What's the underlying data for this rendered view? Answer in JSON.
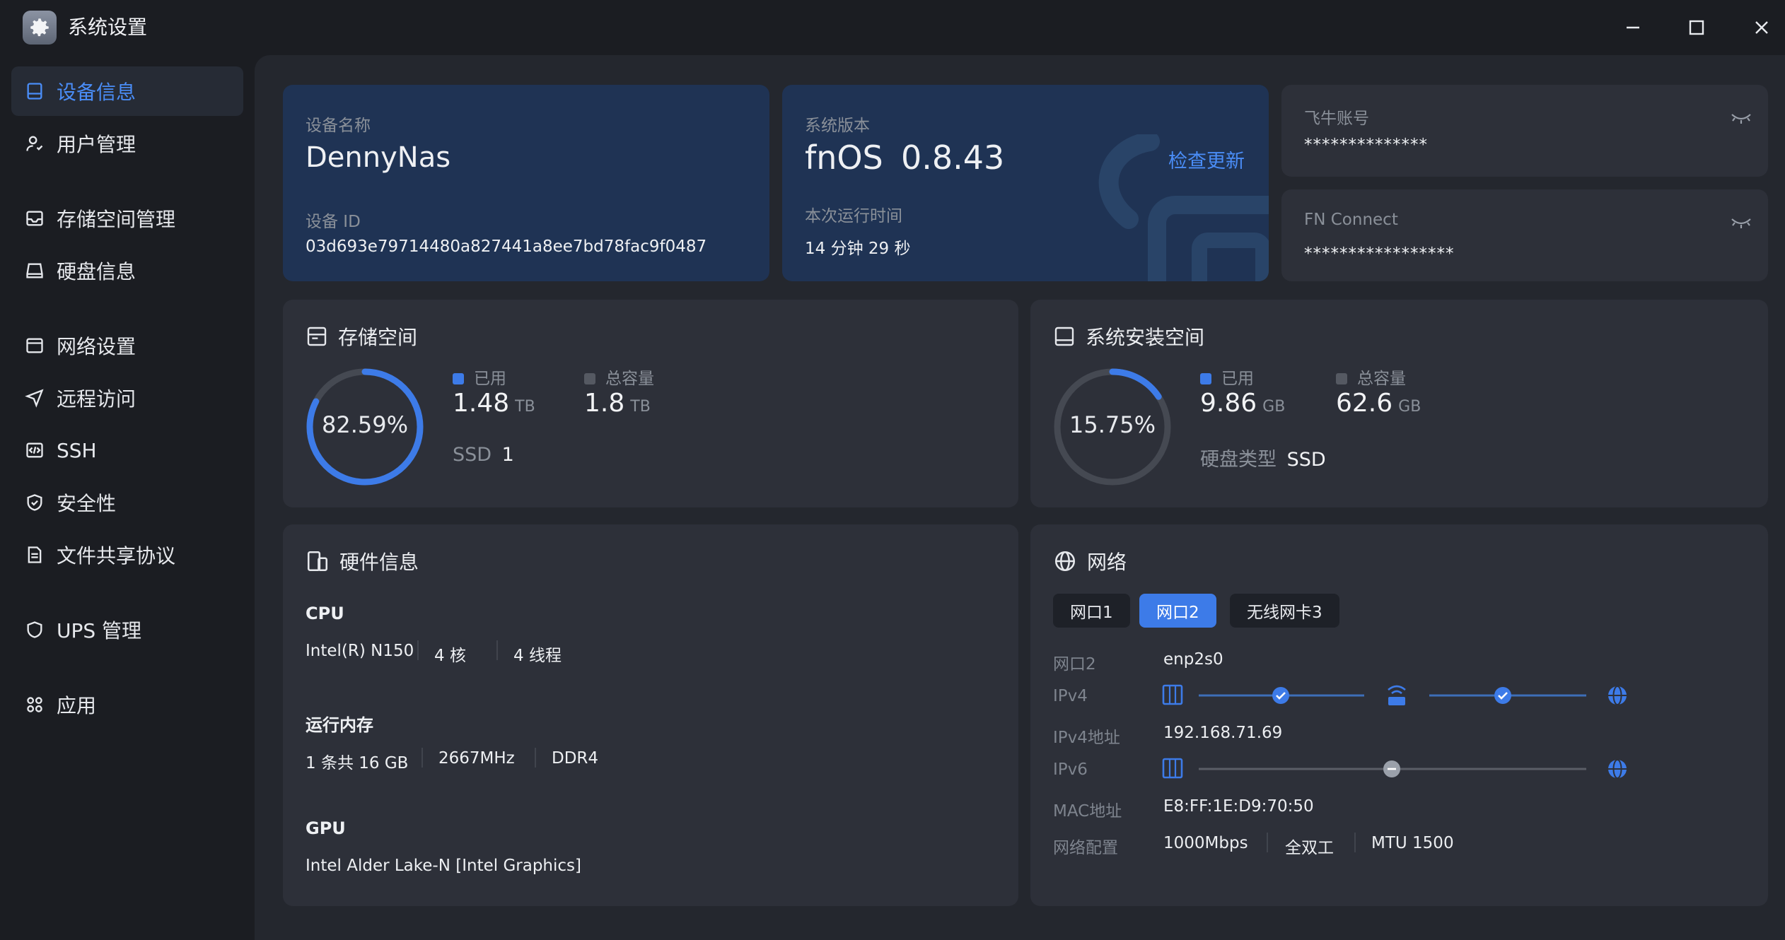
{
  "window": {
    "title": "系统设置"
  },
  "sidebar": {
    "items": [
      {
        "label": "设备信息"
      },
      {
        "label": "用户管理"
      },
      {
        "label": "存储空间管理"
      },
      {
        "label": "硬盘信息"
      },
      {
        "label": "网络设置"
      },
      {
        "label": "远程访问"
      },
      {
        "label": "SSH"
      },
      {
        "label": "安全性"
      },
      {
        "label": "文件共享协议"
      },
      {
        "label": "UPS 管理"
      },
      {
        "label": "应用"
      }
    ]
  },
  "device": {
    "name_label": "设备名称",
    "name": "DennyNas",
    "id_label": "设备 ID",
    "id": "03d693e79714480a827441a8ee7bd78fac9f0487"
  },
  "version": {
    "label": "系统版本",
    "os": "fnOS",
    "number": "0.8.43",
    "check_update": "检查更新",
    "uptime_label": "本次运行时间",
    "uptime": "14 分钟 29 秒"
  },
  "accounts": {
    "fn_account_label": "飞牛账号",
    "fn_account_value": "**************",
    "fn_connect_label": "FN Connect",
    "fn_connect_value": "*****************"
  },
  "storage": {
    "title": "存储空间",
    "percent": "82.59%",
    "fraction": 0.8259,
    "used_label": "已用",
    "used_value": "1.48",
    "used_unit": "TB",
    "total_label": "总容量",
    "total_value": "1.8",
    "total_unit": "TB",
    "disk_type": "SSD",
    "disk_count": "1"
  },
  "sysspace": {
    "title": "系统安装空间",
    "percent": "15.75%",
    "fraction": 0.1575,
    "used_label": "已用",
    "used_value": "9.86",
    "used_unit": "GB",
    "total_label": "总容量",
    "total_value": "62.6",
    "total_unit": "GB",
    "disk_type_label": "硬盘类型",
    "disk_type": "SSD"
  },
  "hardware": {
    "title": "硬件信息",
    "cpu_label": "CPU",
    "cpu": [
      "Intel(R) N150",
      "4 核",
      "4 线程"
    ],
    "memory_label": "运行内存",
    "memory": [
      "1 条共 16 GB",
      "2667MHz",
      "DDR4"
    ],
    "gpu_label": "GPU",
    "gpu": "Intel Alder Lake-N [Intel Graphics]"
  },
  "network": {
    "title": "网络",
    "tabs": [
      "网口1",
      "网口2",
      "无线网卡3"
    ],
    "rows": {
      "port_label": "网口2",
      "port_value": "enp2s0",
      "ipv4_label": "IPv4",
      "ipv4_addr_label": "IPv4地址",
      "ipv4_addr": "192.168.71.69",
      "ipv6_label": "IPv6",
      "mac_label": "MAC地址",
      "mac": "E8:FF:1E:D9:70:50",
      "config_label": "网络配置",
      "config": [
        "1000Mbps",
        "全双工",
        "MTU 1500"
      ]
    }
  },
  "colors": {
    "accent": "#3d7be8",
    "ring_track": "#454952",
    "bg": "#1b1d22",
    "card": "#2d3039"
  }
}
